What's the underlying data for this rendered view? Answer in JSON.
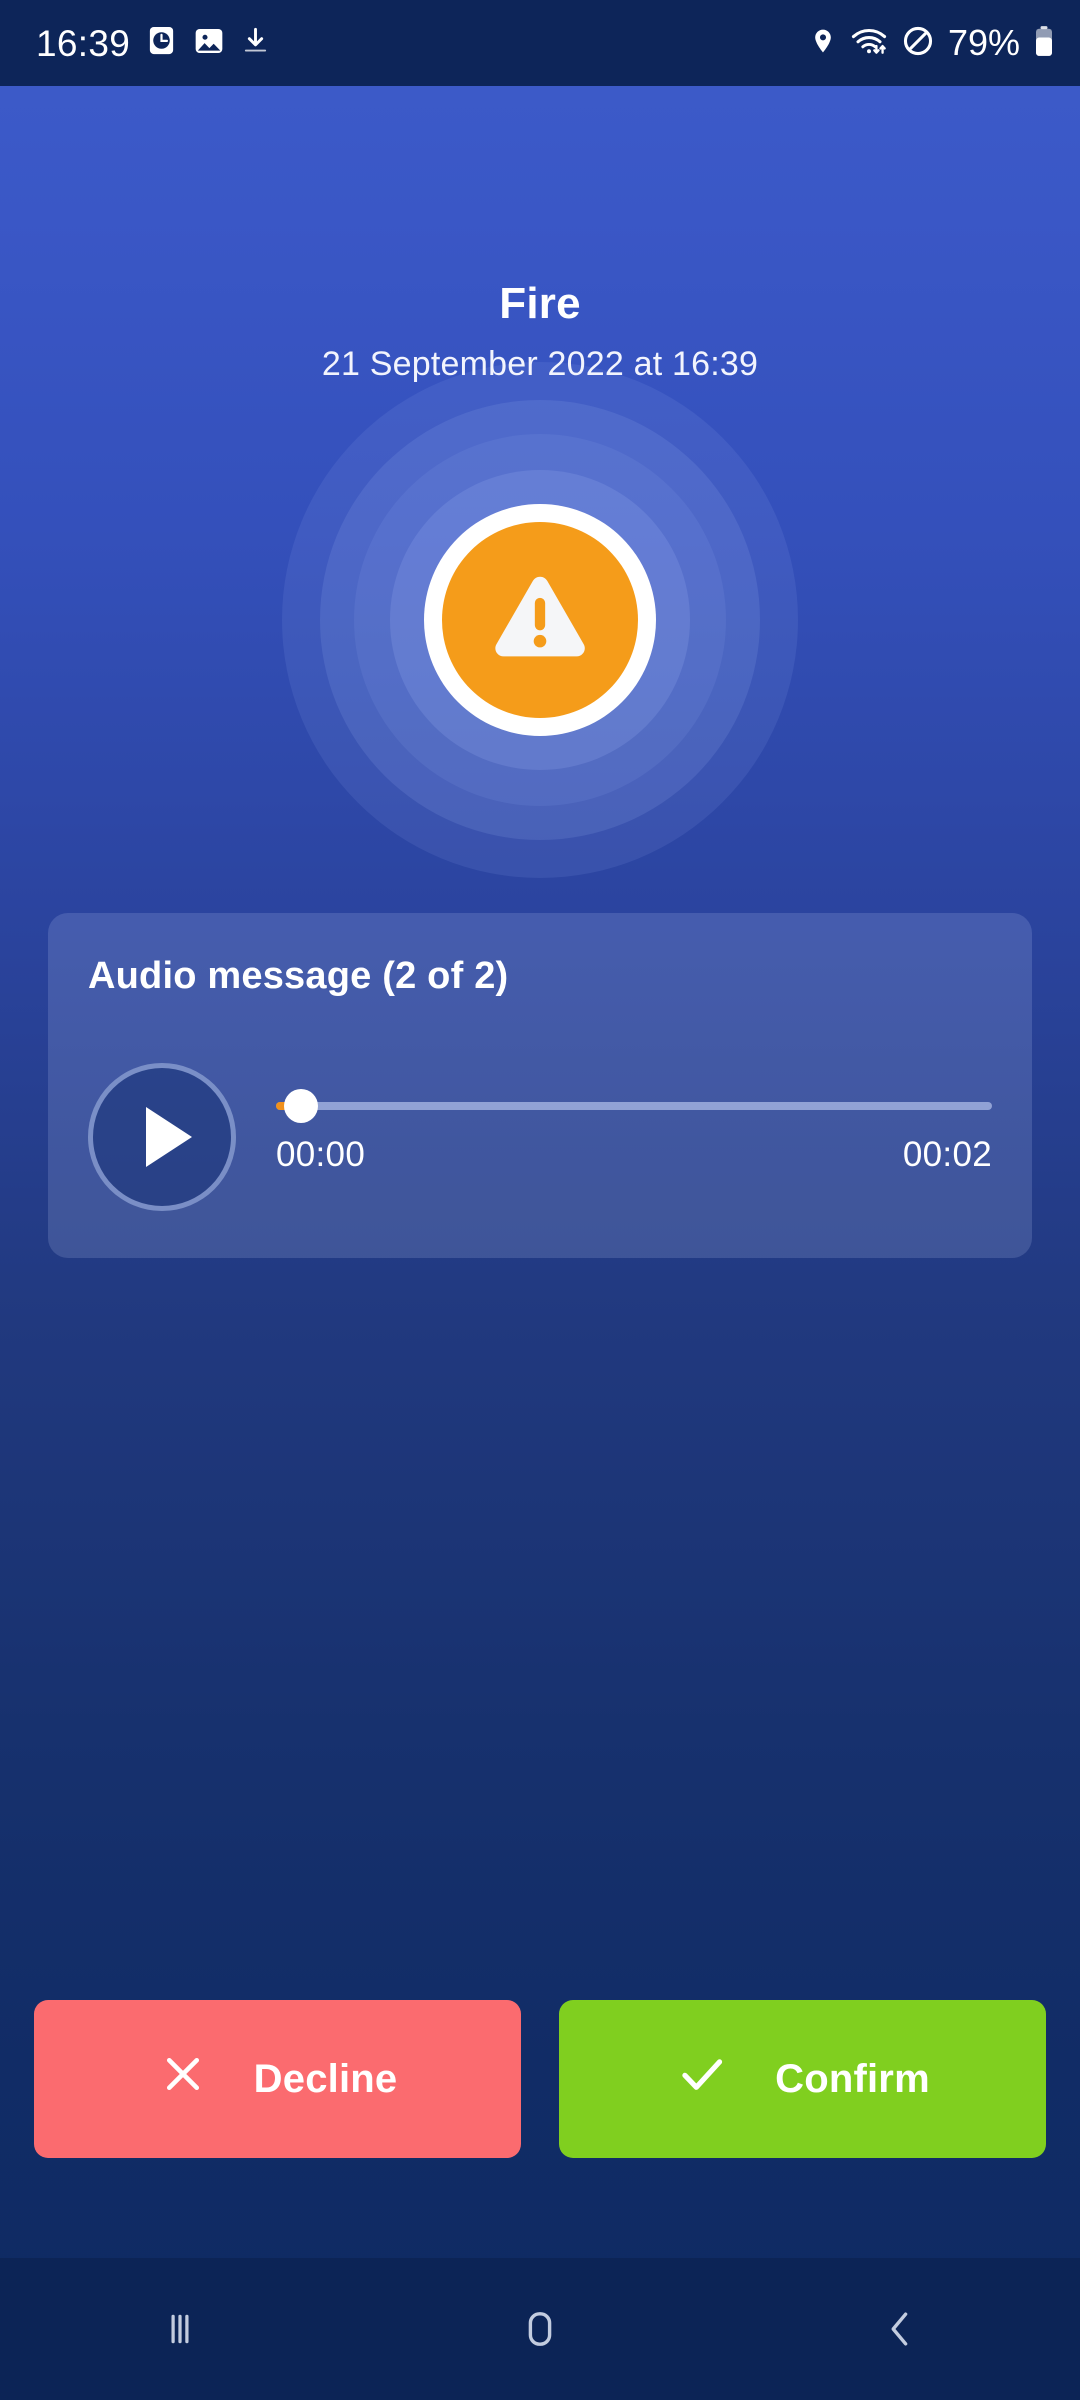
{
  "status_bar": {
    "time": "16:39",
    "battery_percent": "79%",
    "left_icons": [
      "clock-icon",
      "image-icon",
      "download-icon"
    ],
    "right_icons": [
      "location-pin-icon",
      "wifi-icon",
      "do-not-disturb-icon",
      "battery-icon"
    ]
  },
  "alert": {
    "title": "Fire",
    "timestamp": "21 September 2022 at 16:39",
    "icon": "warning-triangle-icon",
    "icon_color": "#f59c1a"
  },
  "audio": {
    "title": "Audio message (2 of 2)",
    "play_icon": "play-icon",
    "current_time": "00:00",
    "total_time": "00:02",
    "progress_percent": 1,
    "progress_color": "#f0901c"
  },
  "actions": {
    "decline": {
      "label": "Decline",
      "icon": "close-x-icon",
      "color": "#fb6b6f"
    },
    "confirm": {
      "label": "Confirm",
      "icon": "check-icon",
      "color": "#80cf1f"
    }
  },
  "navigation_bar": {
    "recents": "recents-icon",
    "home": "home-icon",
    "back": "back-icon"
  }
}
